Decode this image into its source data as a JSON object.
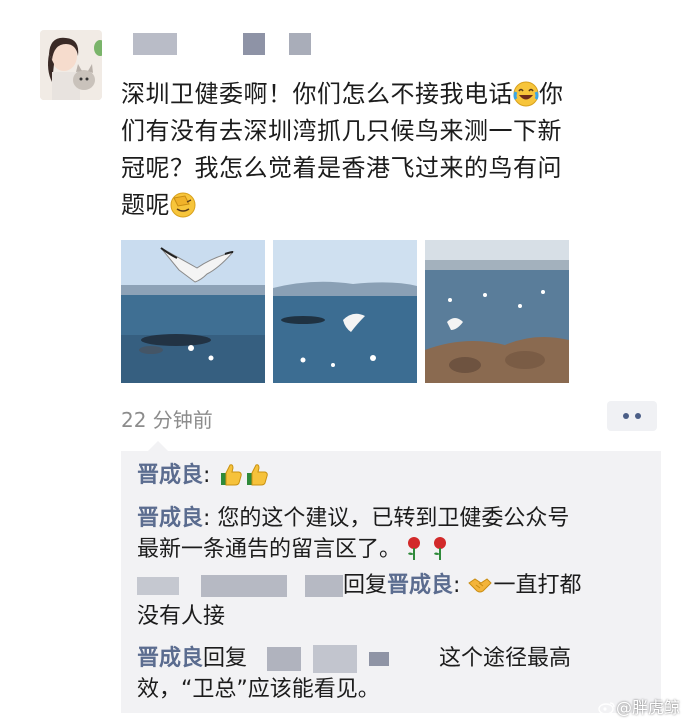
{
  "post": {
    "line1_a": "深圳卫健委啊！你们怎么不接我电话",
    "line1_b": "你",
    "line2": "们有没有去深圳湾抓几只候鸟来测一下新",
    "line3": "冠呢？我怎么觉着是香港飞过来的鸟有问",
    "line4": "题呢",
    "timestamp": "22 分钟前"
  },
  "comments": [
    {
      "user": "晋成良",
      "sep": ": ",
      "text": ""
    },
    {
      "user": "晋成良",
      "sep": ": ",
      "text": "您的这个建议，已转到卫健委公众号",
      "text2": "最新一条通告的留言区了。"
    },
    {
      "reply_word": "回复",
      "reply_to": "晋成良",
      "sep": ": ",
      "text": "一直打都",
      "text2": "没有人接"
    },
    {
      "user": "晋成良",
      "reply_word": "回复",
      "text": "这个途径最高",
      "text2": "效，“卫总”应该能看见。"
    }
  ],
  "watermark": "@胖虎鲸",
  "icons": [
    "avatar-photo",
    "laughing-crying-emoji",
    "facepalm-emoji",
    "thumbs-up-emoji",
    "rose-emoji",
    "handshake-emoji",
    "more-options-icon",
    "weibo-logo-icon"
  ],
  "colors": {
    "username": "#5b6c8f",
    "timestamp": "#8c8c8c",
    "comment_bg": "#f2f2f4",
    "text": "#1c1c1c"
  }
}
